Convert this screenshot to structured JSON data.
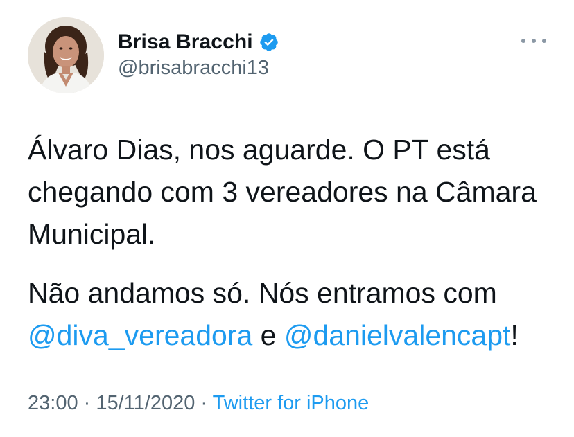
{
  "author": {
    "display_name": "Brisa Bracchi",
    "handle": "@brisabracchi13",
    "verified_icon": "verified-badge-icon",
    "avatar_icon": "profile-photo"
  },
  "more_icon": "more-options-icon",
  "tweet": {
    "paragraph1": "Álvaro Dias, nos aguarde. O PT está chegando com 3 vereadores na Câmara Municipal.",
    "paragraph2_text": "Não andamos só. Nós entramos com ",
    "mention1": "@diva_vereadora",
    "connector": " e ",
    "mention2": "@danielvalencapt",
    "end": "!"
  },
  "meta": {
    "time": "23:00",
    "sep1": " · ",
    "date": "15/11/2020",
    "sep2": " · ",
    "source": "Twitter for iPhone"
  },
  "colors": {
    "link": "#1d9bf0",
    "secondary": "#536471",
    "text": "#0f1419",
    "verified": "#1d9bf0"
  }
}
